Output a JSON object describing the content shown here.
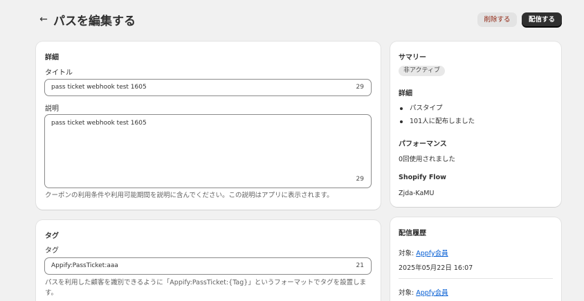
{
  "header": {
    "back_icon": "←",
    "title": "パスを編集する",
    "delete_label": "削除する",
    "publish_label": "配信する"
  },
  "details_card": {
    "heading": "詳細",
    "title_label": "タイトル",
    "title_value": "pass ticket webhook test 1605",
    "title_count": "29",
    "description_label": "説明",
    "description_value": "pass ticket webhook test 1605",
    "description_count": "29",
    "description_help": "クーポンの利用条件や利用可能期間を説明に含んでください。この説明はアプリに表示されます。"
  },
  "tag_card": {
    "heading": "タグ",
    "tag_label": "タグ",
    "tag_value": "Appify:PassTicket:aaa",
    "tag_count": "21",
    "tag_help": "パスを利用した顧客を識別できるように「Appify:PassTicket:{Tag}」というフォーマットでタグを設置します。"
  },
  "summary_card": {
    "heading": "サマリー",
    "status_badge": "非アクティブ",
    "details_heading": "詳細",
    "details_items": [
      "パスタイプ",
      "101人に配布しました"
    ],
    "performance_heading": "パフォーマンス",
    "performance_text": "0回使用されました",
    "flow_heading": "Shopify Flow",
    "flow_value": "Zjda-KaMU"
  },
  "history_card": {
    "heading": "配信履歴",
    "entries": [
      {
        "target_label": "対象:",
        "target_link": "Appfy会員",
        "date": "2025年05月22日 16:07"
      },
      {
        "target_label": "対象:",
        "target_link": "Appfy会員"
      }
    ]
  },
  "colors": {
    "background": "#f1f1f1",
    "card": "#ffffff",
    "primary_button": "#303030",
    "delete_text": "#8e1f0b",
    "link": "#005bd3"
  }
}
